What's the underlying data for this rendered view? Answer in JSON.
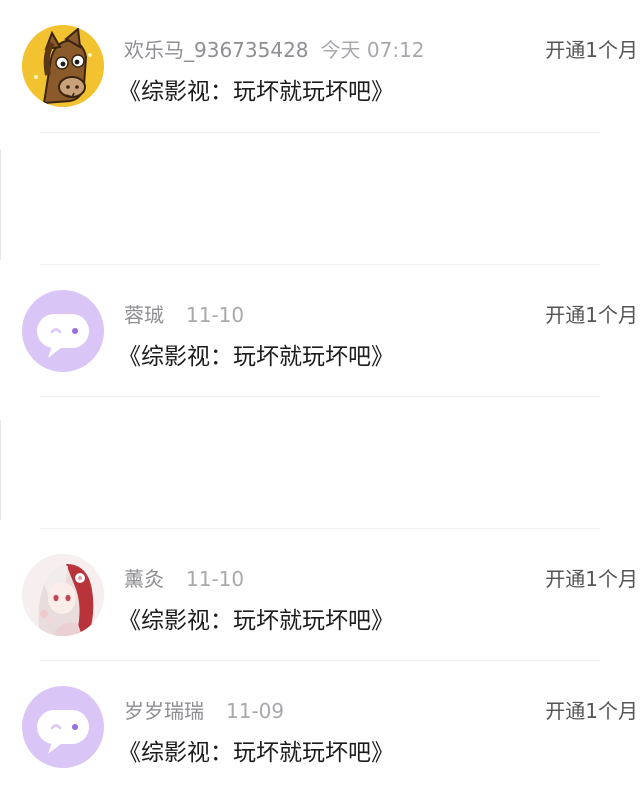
{
  "items": [
    {
      "avatar": "horse-avatar",
      "name": "欢乐马_936735428",
      "date": "今天 07:12",
      "action": "开通1个月",
      "title": "《综影视：玩坏就玩坏吧》"
    },
    {
      "avatar": "default-chat-avatar",
      "name": "蓉珹",
      "date": "11-10",
      "action": "开通1个月",
      "title": "《综影视：玩坏就玩坏吧》"
    },
    {
      "avatar": "anime-girl-avatar",
      "name": "薰灸",
      "date": "11-10",
      "action": "开通1个月",
      "title": "《综影视：玩坏就玩坏吧》"
    },
    {
      "avatar": "default-chat-avatar",
      "name": "岁岁瑞瑞",
      "date": "11-09",
      "action": "开通1个月",
      "title": "《综影视：玩坏就玩坏吧》"
    }
  ],
  "colors": {
    "chat_avatar_bg": "#d9c6f7",
    "horse_bg": "#f2c230",
    "action_text": "#555555"
  }
}
